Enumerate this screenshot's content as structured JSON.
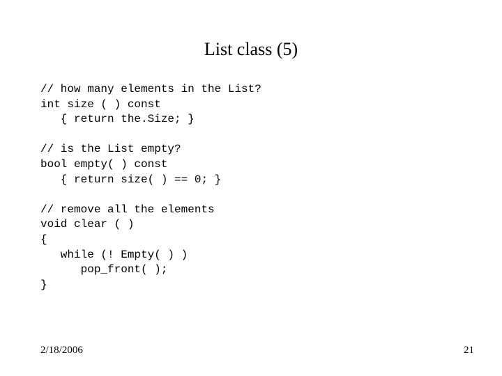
{
  "title": "List class (5)",
  "code_lines": [
    "// how many elements in the List?",
    "int size ( ) const",
    "   { return the.Size; }",
    "",
    "// is the List empty?",
    "bool empty( ) const",
    "   { return size( ) == 0; }",
    "",
    "// remove all the elements",
    "void clear ( )",
    "{",
    "   while (! Empty( ) )",
    "      pop_front( );",
    "}"
  ],
  "footer": {
    "date": "2/18/2006",
    "page": "21"
  }
}
